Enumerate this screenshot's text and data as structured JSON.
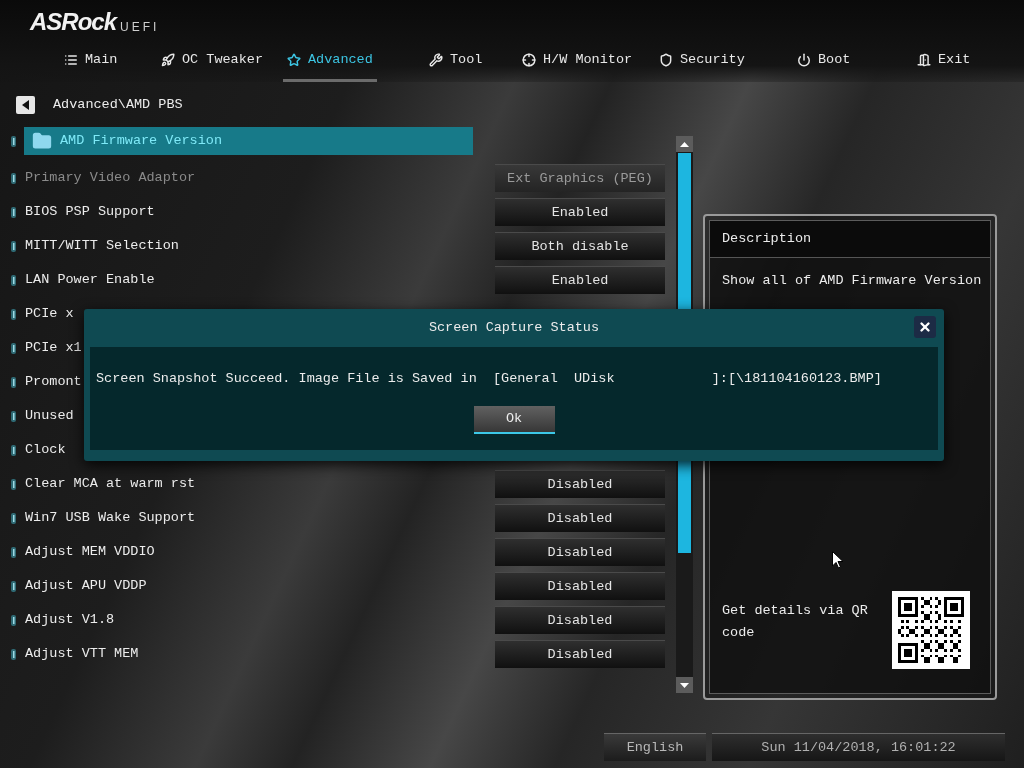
{
  "logo": {
    "brand": "ASRock",
    "product": "UEFI"
  },
  "tabs": [
    {
      "label": "Main",
      "selected": false
    },
    {
      "label": "OC Tweaker",
      "selected": false
    },
    {
      "label": "Advanced",
      "selected": true
    },
    {
      "label": "Tool",
      "selected": false
    },
    {
      "label": "H/W Monitor",
      "selected": false
    },
    {
      "label": "Security",
      "selected": false
    },
    {
      "label": "Boot",
      "selected": false
    },
    {
      "label": "Exit",
      "selected": false
    }
  ],
  "breadcrumb": "Advanced\\AMD PBS",
  "settings": [
    {
      "kind": "folder",
      "label": "AMD Firmware Version",
      "selected": true,
      "disabled": false
    },
    {
      "kind": "option",
      "label": "Primary Video Adaptor",
      "value": "Ext Graphics (PEG)",
      "selected": false,
      "disabled": true
    },
    {
      "kind": "option",
      "label": "BIOS PSP Support",
      "value": "Enabled",
      "selected": false,
      "disabled": false
    },
    {
      "kind": "option",
      "label": "MITT/WITT Selection",
      "value": "Both disable",
      "selected": false,
      "disabled": false
    },
    {
      "kind": "option",
      "label": "LAN Power Enable",
      "value": "Enabled",
      "selected": false,
      "disabled": false
    },
    {
      "kind": "option",
      "label": "PCIe x",
      "selected": false,
      "disabled": false
    },
    {
      "kind": "option",
      "label": "PCIe x1",
      "selected": false,
      "disabled": false
    },
    {
      "kind": "option",
      "label": "Promont",
      "selected": false,
      "disabled": false
    },
    {
      "kind": "option",
      "label": "Unused",
      "selected": false,
      "disabled": false
    },
    {
      "kind": "option",
      "label": "Clock",
      "selected": false,
      "disabled": false
    },
    {
      "kind": "option",
      "label": "Clear MCA at warm rst",
      "value": "Disabled",
      "selected": false,
      "disabled": false
    },
    {
      "kind": "option",
      "label": "Win7 USB Wake Support",
      "value": "Disabled",
      "selected": false,
      "disabled": false
    },
    {
      "kind": "option",
      "label": "Adjust MEM VDDIO",
      "value": "Disabled",
      "selected": false,
      "disabled": false
    },
    {
      "kind": "option",
      "label": "Adjust APU VDDP",
      "value": "Disabled",
      "selected": false,
      "disabled": false
    },
    {
      "kind": "option",
      "label": "Adjust V1.8",
      "value": "Disabled",
      "selected": false,
      "disabled": false
    },
    {
      "kind": "option",
      "label": "Adjust VTT MEM",
      "value": "Disabled",
      "selected": false,
      "disabled": false
    }
  ],
  "description": {
    "title": "Description",
    "text": "Show all of AMD Firmware Version",
    "qr_hint": "Get details via QR code"
  },
  "footer": {
    "language": "English",
    "datetime": "Sun 11/04/2018, 16:01:22"
  },
  "dialog": {
    "title": "Screen Capture Status",
    "message": "Screen Snapshot Succeed. Image File is Saved in  [General  UDisk            ]:[\\181104160123.BMP]",
    "button": "Ok"
  }
}
